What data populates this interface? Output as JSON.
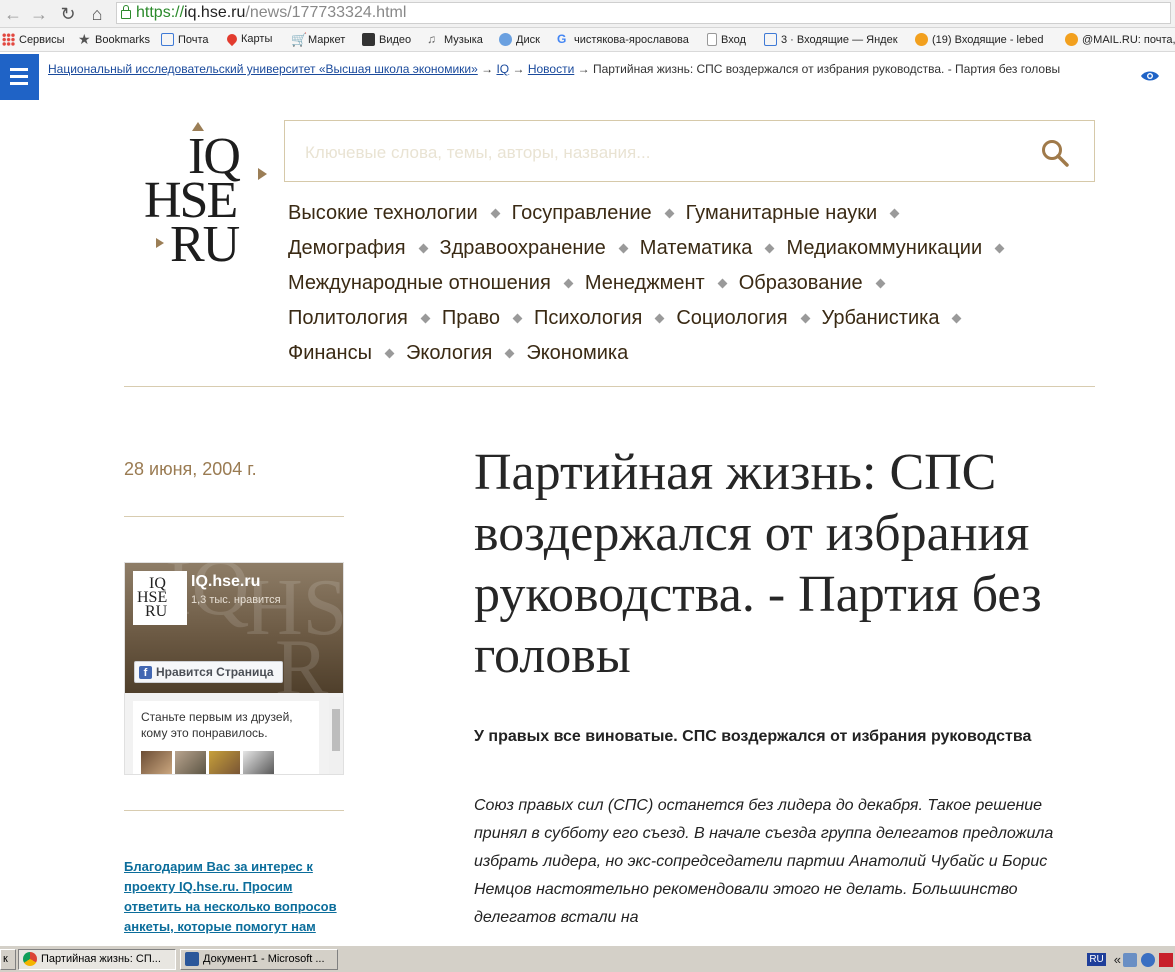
{
  "browser": {
    "url_scheme": "https://",
    "url_host": "iq.hse.ru",
    "url_path": "/news/177733324.html",
    "bookmarks": [
      {
        "label": "Сервисы",
        "color": "#e2473f"
      },
      {
        "label": "Bookmarks",
        "color": "#555555"
      },
      {
        "label": "Почта",
        "color": "#3f7ad6"
      },
      {
        "label": "Карты",
        "color": "#e23b2e"
      },
      {
        "label": "Маркет",
        "color": "#2f6ec6"
      },
      {
        "label": "Видео",
        "color": "#333333"
      },
      {
        "label": "Музыка",
        "color": "#666666"
      },
      {
        "label": "Диск",
        "color": "#6aa0e0"
      },
      {
        "label": "чистякова-ярославова",
        "color": "#4285f4"
      },
      {
        "label": "Вход",
        "color": "#999999"
      },
      {
        "label": "3 · Входящие — Яндек",
        "color": "#3f7ad6"
      },
      {
        "label": "(19) Входящие - lebed",
        "color": "#f2a01e"
      },
      {
        "label": "@MAIL.RU: почта,",
        "color": "#f2a01e"
      }
    ]
  },
  "breadcrumb": {
    "link1": "Национальный исследовательский университет «Высшая школа экономики»",
    "arrow": "→",
    "link2": "IQ",
    "link3": "Новости",
    "current": "Партийная жизнь: СПС воздержался от избрания руководства. - Партия без головы"
  },
  "logo": {
    "line1": "IQ",
    "line2": "HSE",
    "line3": "RU"
  },
  "search": {
    "placeholder": "Ключевые слова, темы, авторы, названия..."
  },
  "topics": [
    [
      "Высокие технологии",
      "Госуправление",
      "Гуманитарные науки"
    ],
    [
      "Демография",
      "Здравоохранение",
      "Математика",
      "Медиакоммуникации"
    ],
    [
      "Международные отношения",
      "Менеджмент",
      "Образование"
    ],
    [
      "Политология",
      "Право",
      "Психология",
      "Социология",
      "Урбанистика"
    ],
    [
      "Финансы",
      "Экология",
      "Экономика"
    ]
  ],
  "article": {
    "date": "28 июня, 2004 г.",
    "title": "Партийная жизнь: СПС воздержался от избрания руководства. - Партия без головы",
    "lead": "У правых все виноватые. СПС воздержался от избрания руководства",
    "body": "Союз правых сил (СПС) останется без лидера до декабря. Такое решение принял в субботу его съезд. В начале съезда группа делегатов предложила избрать лидера, но экс-сопредседатели партии Анатолий Чубайс и Борис Немцов настоятельно рекомендовали этого не делать. Большинство делегатов встали на"
  },
  "facebook": {
    "page_name": "IQ.hse.ru",
    "likes": "1,3 тыс. нравится",
    "like_button": "Нравится Страница",
    "friends_text": "Станьте первым из друзей, кому это понравилось."
  },
  "survey": {
    "text": "Благодарим Вас за интерес к проекту IQ.hse.ru. Просим ответить на несколько вопросов анкеты, которые помогут нам"
  },
  "taskbar": {
    "start": "к",
    "task1": "Партийная жизнь: СП...",
    "task2": "Документ1 - Microsoft ...",
    "lang": "RU",
    "tray_arrows": "«"
  },
  "colors": {
    "accent_blue": "#1f63c6",
    "gold": "#9b7e56",
    "link": "#0b6d9b"
  }
}
